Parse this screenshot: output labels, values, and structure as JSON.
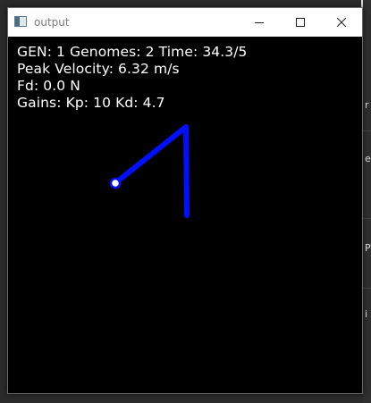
{
  "window": {
    "title": "output",
    "icon": "app-window-icon",
    "controls": [
      "minimize-icon",
      "maximize-icon",
      "close-icon"
    ]
  },
  "hud": {
    "line1": "GEN: 1 Genomes: 2 Time: 34.3/5",
    "line2": "Peak Velocity: 6.32 m/s",
    "line3": "Fd: 0.0 N",
    "line4": "Gains: Kp: 10 Kd: 4.7"
  },
  "background": {
    "fragments": [
      "r",
      "e",
      "P",
      "i"
    ]
  },
  "colors": {
    "arm": "#0010ff",
    "canvas": "#000000",
    "text": "#ffffff",
    "titlebar": "#ffffff"
  }
}
